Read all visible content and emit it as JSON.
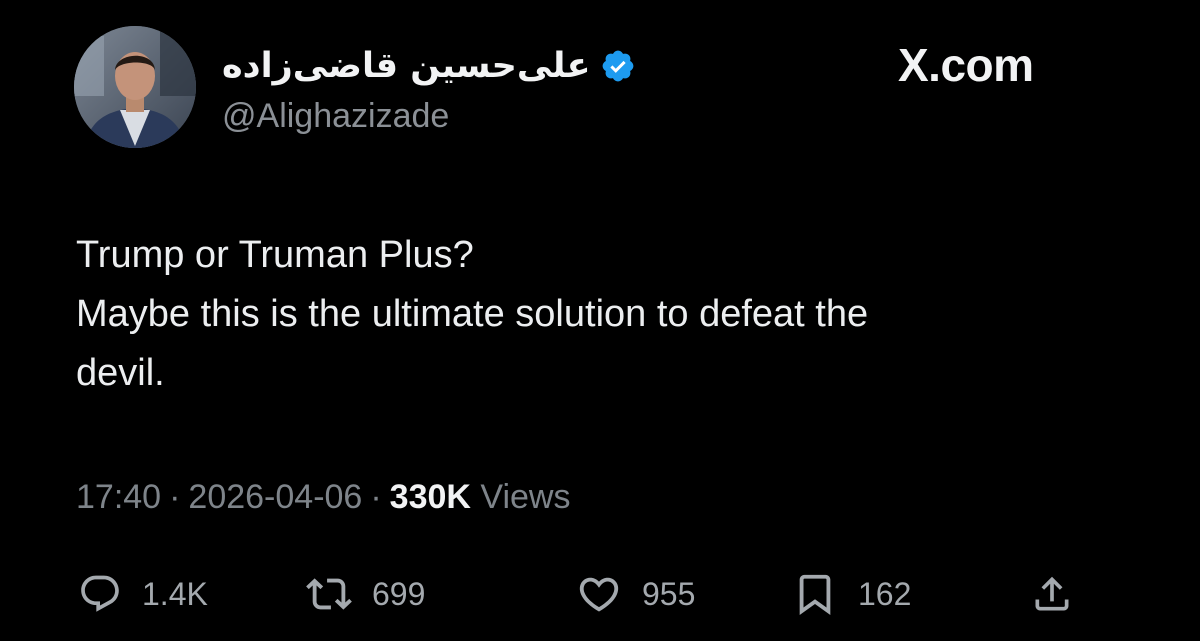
{
  "brand": "X.com",
  "author": {
    "display_name": "علی‌حسین قاضی‌زاده",
    "handle": "@Alighazizade",
    "verified": true
  },
  "tweet": {
    "lines": [
      "Trump or Truman Plus?",
      "Maybe this is the ultimate solution to defeat the",
      "devil."
    ]
  },
  "meta": {
    "time": "17:40",
    "separator": "·",
    "date": "2026-04-06",
    "views_count": "330K",
    "views_label": "Views"
  },
  "actions": {
    "replies": "1.4K",
    "reposts": "699",
    "likes": "955",
    "bookmarks": "162"
  },
  "colors": {
    "background": "#000000",
    "verified_badge": "#1d9bf0",
    "primary_text": "#e7e9ea",
    "secondary_text": "#7e848a"
  }
}
